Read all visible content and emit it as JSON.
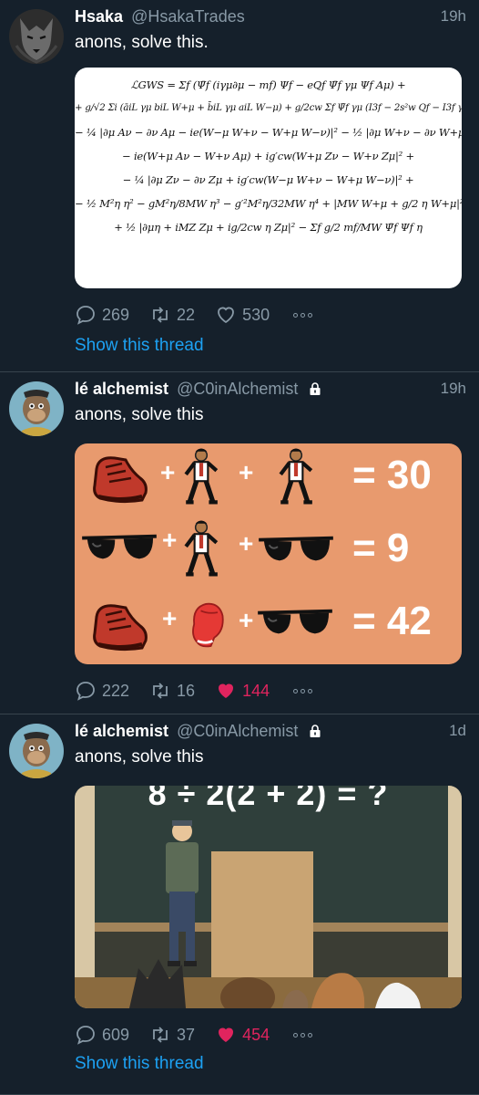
{
  "tweets": [
    {
      "name": "Hsaka",
      "handle": "@HsakaTrades",
      "time": "19h",
      "text": "anons, solve this.",
      "replies": "269",
      "retweets": "22",
      "likes": "530",
      "show_thread": "Show this thread",
      "equation_lines": [
        "ℒGWS = Σf (Ψ̄f (iγμ∂μ − mf) Ψf − eQf Ψ̄f γμ Ψf Aμ) +",
        "+ g/√2 Σi (āiL γμ biL W+μ + b̄iL γμ aiL W−μ) + g/2cw Σf Ψ̄f γμ (I3f − 2s²w Qf − I3f γ5) Ψf Zμ +",
        "− ¼ |∂μ Aν − ∂ν Aμ − ie(W−μ W+ν − W+μ W−ν)|² − ½ |∂μ W+ν − ∂ν W+μ +",
        "− ie(W+μ Aν − W+ν Aμ) + ig′cw(W+μ Zν − W+ν Zμ|² +",
        "− ¼ |∂μ Zν − ∂ν Zμ + ig′cw(W−μ W+ν − W+μ W−ν)|² +",
        "− ½ M²η η² − gM²η/8MW η³ − g′²M²η/32MW η⁴ + |MW W+μ + g/2 η W+μ|² +",
        "+ ½ |∂μη + iMZ Zμ + ig/2cw η Zμ|² − Σf g/2 mf/MW Ψ̄f Ψf η"
      ]
    },
    {
      "name": "lé alchemist",
      "handle": "@C0inAlchemist",
      "time": "19h",
      "text": "anons, solve this",
      "replies": "222",
      "retweets": "16",
      "likes": "144",
      "puzzle": {
        "plus": "+",
        "results": [
          "= 30",
          "= 9",
          "= 42"
        ]
      }
    },
    {
      "name": "lé alchemist",
      "handle": "@C0inAlchemist",
      "time": "1d",
      "text": "anons, solve this",
      "replies": "609",
      "retweets": "37",
      "likes": "454",
      "show_thread": "Show this thread",
      "board_text": "8 ÷ 2(2 + 2) = ?"
    }
  ],
  "colors": {
    "background": "#15202b",
    "link": "#1da1f2",
    "like": "#e0245e",
    "muted": "#8899a6"
  },
  "icons": [
    "reply-icon",
    "retweet-icon",
    "like-icon",
    "more-icon",
    "lock-icon"
  ]
}
